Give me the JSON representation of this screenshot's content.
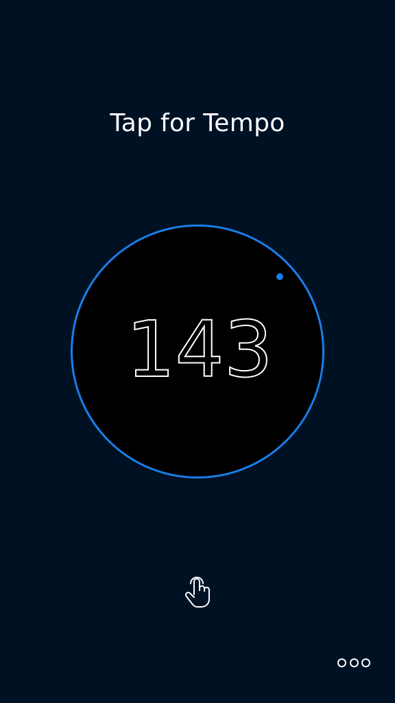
{
  "screen": {
    "title": "Tap for Tempo"
  },
  "tempo": {
    "bpm": "143",
    "ring_color": "#1a7ee8",
    "beat_indicator_color": "#1a7ee8"
  },
  "icons": {
    "tap_hint": "hand-tap-icon",
    "more": "more-icon"
  },
  "colors": {
    "background": "#001124",
    "text": "#ffffff"
  }
}
